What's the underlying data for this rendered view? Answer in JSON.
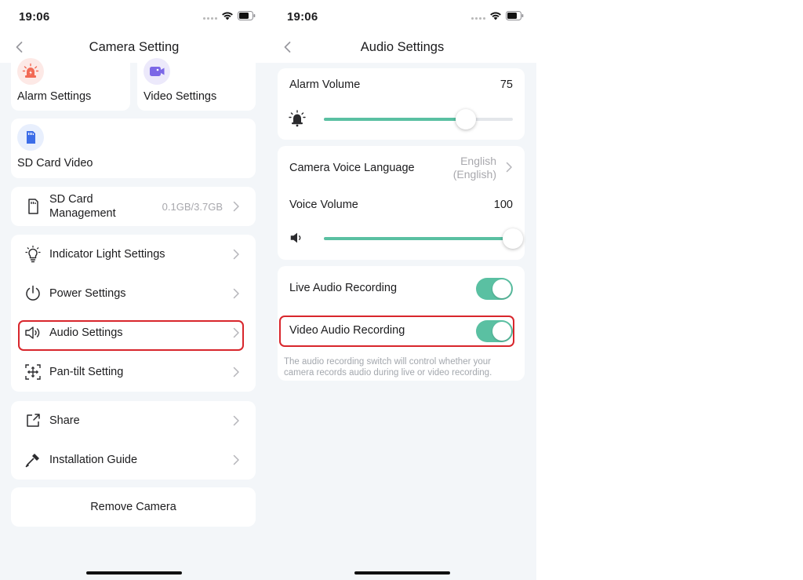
{
  "status_bar": {
    "time": "19:06",
    "signal_icon": "signal-dots-icon",
    "wifi_icon": "wifi-icon",
    "battery_icon": "battery-icon"
  },
  "left_screen": {
    "nav": {
      "title": "Camera Setting",
      "back_icon": "chevron-left-icon"
    },
    "tiles": {
      "alarm": {
        "label": "Alarm Settings",
        "icon": "alarm-light-icon"
      },
      "video": {
        "label": "Video Settings",
        "icon": "video-icon"
      },
      "sd_video": {
        "label": "SD Card Video",
        "icon": "sd-card-icon"
      }
    },
    "sd_management": {
      "label_line1": "SD Card",
      "label_line2": "Management",
      "value": "0.1GB/3.7GB",
      "icon": "sd-card-outline-icon"
    },
    "settings_group": [
      {
        "label": "Indicator Light Settings",
        "icon": "light-bulb-icon"
      },
      {
        "label": "Power Settings",
        "icon": "power-icon"
      },
      {
        "label": "Audio Settings",
        "icon": "speaker-icon"
      },
      {
        "label": "Pan-tilt Setting",
        "icon": "pan-tilt-icon"
      }
    ],
    "share_group": [
      {
        "label": "Share",
        "icon": "share-icon"
      },
      {
        "label": "Installation Guide",
        "icon": "screwdriver-icon"
      }
    ],
    "remove_label": "Remove Camera"
  },
  "right_screen": {
    "nav": {
      "title": "Audio Settings",
      "back_icon": "chevron-left-icon"
    },
    "alarm_volume": {
      "label": "Alarm Volume",
      "value": "75",
      "fraction": 0.75,
      "icon": "alarm-bell-icon"
    },
    "voice_language": {
      "label": "Camera Voice Language",
      "value_line1": "English",
      "value_line2": "(English)"
    },
    "voice_volume": {
      "label": "Voice Volume",
      "value": "100",
      "fraction": 1.0,
      "icon": "speaker-icon"
    },
    "live_audio": {
      "label": "Live Audio Recording",
      "enabled": true
    },
    "video_audio": {
      "label": "Video Audio Recording",
      "enabled": true
    },
    "hint": "The audio recording switch will control whether your camera records audio during live or video recording."
  },
  "colors": {
    "accent": "#5ac0a2",
    "highlight": "#d8262c",
    "background": "#f3f6f9"
  }
}
